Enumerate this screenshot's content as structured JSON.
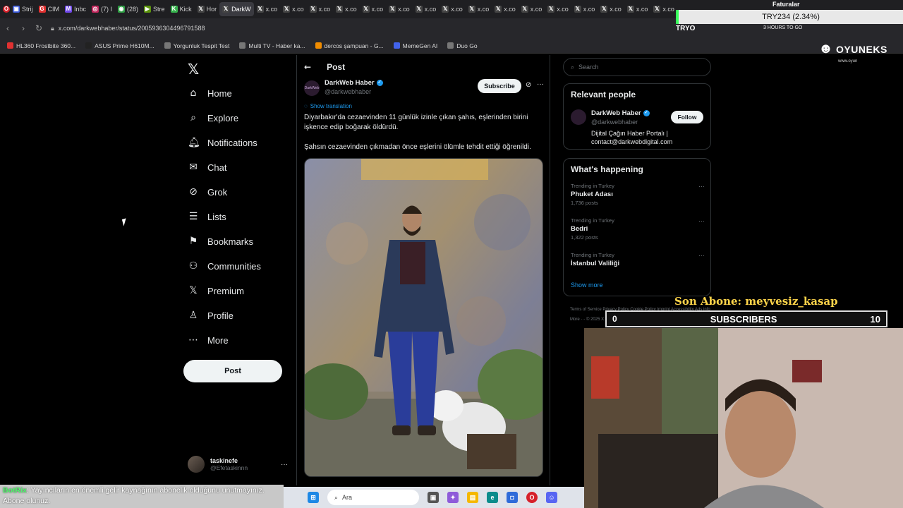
{
  "browser": {
    "tabs": [
      {
        "label": "Strij",
        "color": "#3b5bdb",
        "glyph": "▣"
      },
      {
        "label": "CIM",
        "color": "#e03131",
        "glyph": "G"
      },
      {
        "label": "Inbc",
        "color": "#7048e8",
        "glyph": "M"
      },
      {
        "label": "(7) I",
        "color": "#c2255c",
        "glyph": "◎"
      },
      {
        "label": "(28)",
        "color": "#2f9e44",
        "glyph": "◉"
      },
      {
        "label": "Stre",
        "color": "#5c940d",
        "glyph": "▶"
      },
      {
        "label": "Kick",
        "color": "#37b24d",
        "glyph": "K"
      },
      {
        "label": "Hor",
        "color": "#444444",
        "glyph": "𝕏"
      },
      {
        "label": "DarkW",
        "color": "#444444",
        "glyph": "𝕏",
        "active": true
      },
      {
        "label": "x.co",
        "color": "#444444",
        "glyph": "𝕏"
      },
      {
        "label": "x.co",
        "color": "#444444",
        "glyph": "𝕏"
      },
      {
        "label": "x.co",
        "color": "#444444",
        "glyph": "𝕏"
      },
      {
        "label": "x.co",
        "color": "#444444",
        "glyph": "𝕏"
      },
      {
        "label": "x.co",
        "color": "#444444",
        "glyph": "𝕏"
      },
      {
        "label": "x.co",
        "color": "#444444",
        "glyph": "𝕏"
      },
      {
        "label": "x.co",
        "color": "#444444",
        "glyph": "𝕏"
      },
      {
        "label": "x.co",
        "color": "#444444",
        "glyph": "𝕏"
      },
      {
        "label": "x.co",
        "color": "#444444",
        "glyph": "𝕏"
      },
      {
        "label": "x.co",
        "color": "#444444",
        "glyph": "𝕏"
      },
      {
        "label": "x.co",
        "color": "#444444",
        "glyph": "𝕏"
      },
      {
        "label": "x.co",
        "color": "#444444",
        "glyph": "𝕏"
      },
      {
        "label": "x.co",
        "color": "#444444",
        "glyph": "𝕏"
      },
      {
        "label": "x.co",
        "color": "#444444",
        "glyph": "𝕏"
      },
      {
        "label": "x.co",
        "color": "#444444",
        "glyph": "𝕏"
      },
      {
        "label": "x.co",
        "color": "#444444",
        "glyph": "𝕏"
      }
    ],
    "url": "x.com/darkwebhaber/status/2005936304496791588",
    "bookmarks": [
      {
        "label": "HL360 Frostbite 360...",
        "color": "#e03131"
      },
      {
        "label": "ASUS Prime H610M...",
        "color": "#222222"
      },
      {
        "label": "Yorgunluk Tespit Test",
        "color": "#777777"
      },
      {
        "label": "Multi TV - Haber ka...",
        "color": "#777777"
      },
      {
        "label": "dercos şampuan - G...",
        "color": "#f08c00"
      },
      {
        "label": "MemeGen AI",
        "color": "#4263eb"
      },
      {
        "label": "Duo Go",
        "color": "#777777"
      }
    ]
  },
  "nav": {
    "items": [
      {
        "label": "Home",
        "icon": "⌂",
        "name": "home"
      },
      {
        "label": "Explore",
        "icon": "⌕",
        "name": "explore"
      },
      {
        "label": "Notifications",
        "icon": "🔔︎",
        "name": "notifications"
      },
      {
        "label": "Chat",
        "icon": "✉",
        "name": "chat"
      },
      {
        "label": "Grok",
        "icon": "⊘",
        "name": "grok"
      },
      {
        "label": "Lists",
        "icon": "☰",
        "name": "lists"
      },
      {
        "label": "Bookmarks",
        "icon": "⚑",
        "name": "bookmarks"
      },
      {
        "label": "Communities",
        "icon": "⚇",
        "name": "communities"
      },
      {
        "label": "Premium",
        "icon": "𝕏",
        "name": "premium"
      },
      {
        "label": "Profile",
        "icon": "♙",
        "name": "profile"
      },
      {
        "label": "More",
        "icon": "⋯",
        "name": "more"
      }
    ],
    "post_label": "Post",
    "account": {
      "name": "taskinefe",
      "handle": "@Efetaskinnn"
    }
  },
  "post": {
    "header": "Post",
    "author_name": "DarkWeb Haber",
    "author_handle": "@darkwebhaber",
    "avatar_text": "DarkWeb",
    "subscribe_label": "Subscribe",
    "show_translation": "Show translation",
    "text_1": "Diyarbakır'da cezaevinden 11 günlük izinle çıkan şahıs, eşlerinden birini işkence edip boğarak öldürdü.",
    "text_2": "Şahsın cezaevinden çıkmadan önce eşlerini ölümle tehdit ettiği öğrenildi."
  },
  "right": {
    "search_placeholder": "Search",
    "relevant_title": "Relevant people",
    "relevant": {
      "name": "DarkWeb Haber",
      "handle": "@darkwebhaber",
      "bio": "Dijital Çağın Haber Portalı | contact@darkwebdigital.com",
      "follow_label": "Follow"
    },
    "happening_title": "What's happening",
    "trends": [
      {
        "context": "Trending in Turkey",
        "topic": "Phuket Adası",
        "count": "1,736 posts"
      },
      {
        "context": "Trending in Turkey",
        "topic": "Bedri",
        "count": "1,322 posts"
      },
      {
        "context": "Trending in Turkey",
        "topic": "İstanbul Valiliği",
        "count": ""
      }
    ],
    "show_more": "Show more",
    "footer": "Terms of Service   Privacy Policy   Cookie Policy   Imprint   Accessibility   Ads info   More ···   © 2025 X Corp."
  },
  "overlay": {
    "ticker": "TRY234 (2.34%)",
    "faturalar": "Faturalar",
    "tryo": "TRYO",
    "hours": "3 HOURS TO GO",
    "brand": "OYUNEKS",
    "brand_url": "www.oyun",
    "son_abone": "Son Abone: meyvesiz_kasap",
    "subs_left": "0",
    "subs_label": "SUBSCRIBERS",
    "subs_right": "10",
    "bot_name": "BotRix",
    "bot_message": ": Yayıncıların en önemli gelir kaynağının abonelik olduğunu unutmayınız. Abone olunuz.",
    "taskbar_search": "Ara"
  }
}
